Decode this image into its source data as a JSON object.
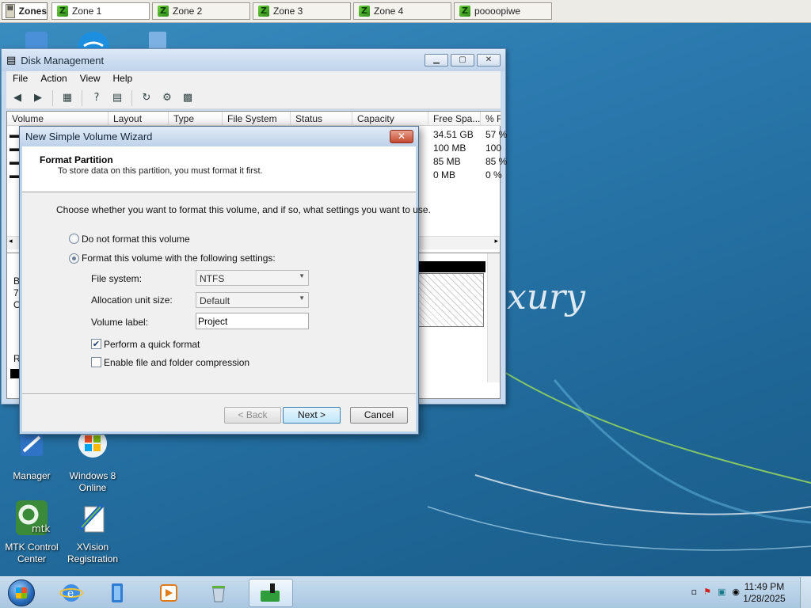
{
  "zones_bar": {
    "menu_label": "Zones",
    "tabs": [
      "Zone 1",
      "Zone 2",
      "Zone 3",
      "Zone 4",
      "poooopiwe"
    ]
  },
  "desktop": {
    "brand_text": "xury",
    "icons": [
      {
        "label": "Manager"
      },
      {
        "label": "Windows 8 Online"
      },
      {
        "label": "MTK Control Center"
      },
      {
        "label": "XVision Registration"
      }
    ],
    "left_edge_glyphs": [
      "B",
      "7(",
      "O",
      "R"
    ]
  },
  "disk_management": {
    "title": "Disk Management",
    "menu": [
      "File",
      "Action",
      "View",
      "Help"
    ],
    "columns": [
      "Volume",
      "Layout",
      "Type",
      "File System",
      "Status",
      "Capacity",
      "Free Spa...",
      "% Fr"
    ],
    "free_space": [
      "34.51 GB",
      "100 MB",
      "85 MB",
      "0 MB"
    ],
    "percent_free": [
      "57 %",
      "100",
      "85 %",
      "0 %"
    ]
  },
  "wizard": {
    "title": "New Simple Volume Wizard",
    "close_glyph": "✕",
    "header_title": "Format Partition",
    "header_subtitle": "To store data on this partition, you must format it first.",
    "instruction": "Choose whether you want to format this volume, and if so, what settings you want to use.",
    "radio_no_format": "Do not format this volume",
    "radio_format": "Format this volume with the following settings:",
    "file_system_label": "File system:",
    "file_system_value": "NTFS",
    "alloc_label": "Allocation unit size:",
    "alloc_value": "Default",
    "volume_label_label": "Volume label:",
    "volume_label_value": "Project",
    "quick_format_label": "Perform a quick format",
    "quick_format_checked": true,
    "compression_label": "Enable file and folder compression",
    "compression_checked": false,
    "back_label": "< Back",
    "next_label": "Next >",
    "cancel_label": "Cancel"
  },
  "taskbar": {
    "clock_time": "11:49 PM",
    "clock_date": "1/28/2025"
  }
}
